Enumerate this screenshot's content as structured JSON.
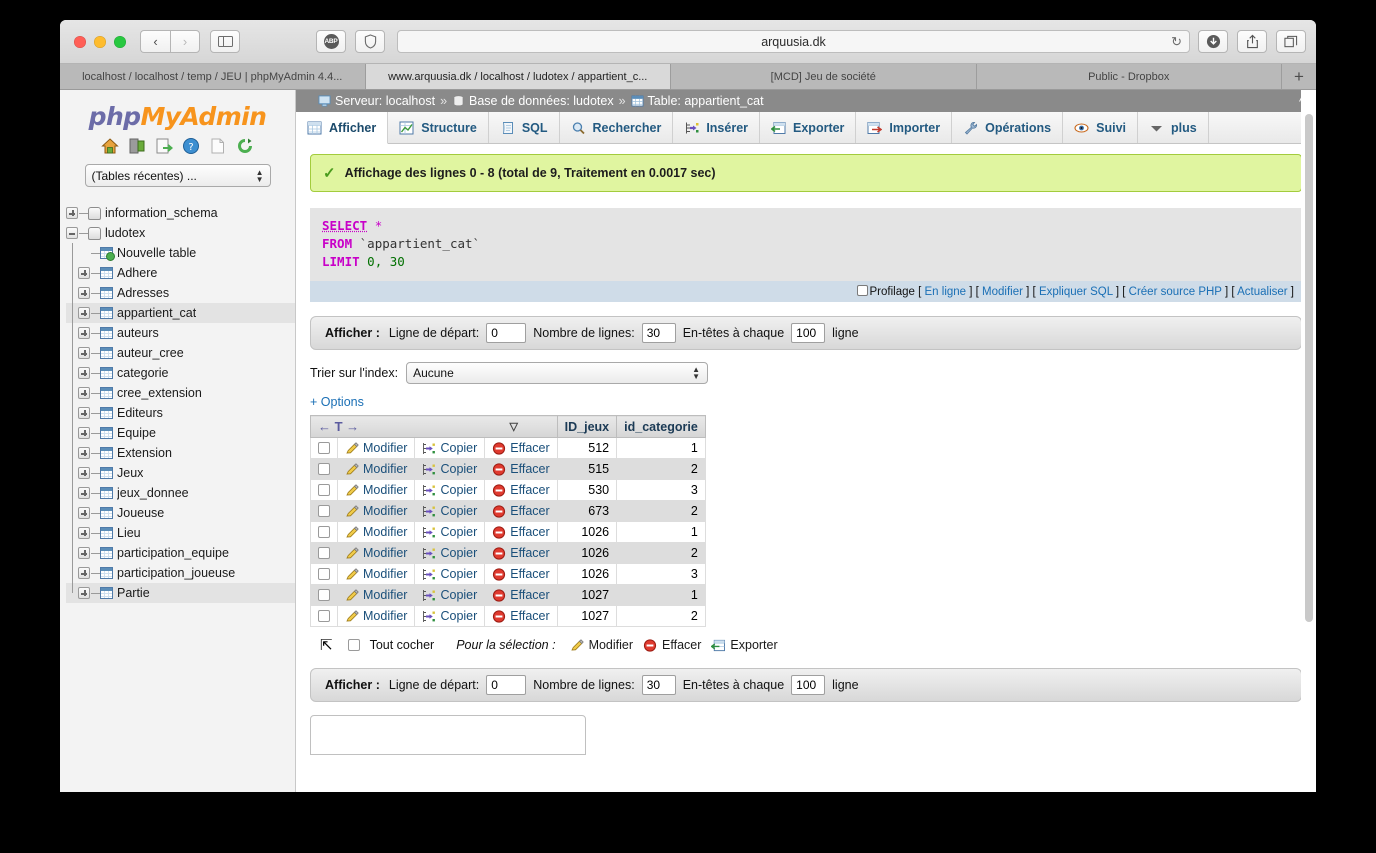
{
  "browser": {
    "url": "arquusia.dk",
    "nav": {
      "back": "‹",
      "forward": "›"
    },
    "tabs": [
      {
        "label": "localhost / localhost / temp / JEU | phpMyAdmin 4.4...",
        "active": false
      },
      {
        "label": "www.arquusia.dk / localhost / ludotex / appartient_c...",
        "active": true
      },
      {
        "label": "[MCD] Jeu de société",
        "active": false
      },
      {
        "label": "Public - Dropbox",
        "active": false
      }
    ],
    "new_tab_label": "+",
    "abp_label": "ABP"
  },
  "sidebar": {
    "logo_php": "php",
    "logo_myadmin": "MyAdmin",
    "icons": [
      "home-icon",
      "exit-icon",
      "export-icon",
      "help-icon",
      "docs-icon",
      "reload-icon"
    ],
    "recent_tables_label": "(Tables récentes) ...",
    "tree": [
      {
        "label": "information_schema",
        "type": "database",
        "toggle": "plus",
        "depth": 0,
        "selected": false
      },
      {
        "label": "ludotex",
        "type": "database",
        "toggle": "minus",
        "depth": 0,
        "selected": false
      },
      {
        "label": "Nouvelle table",
        "type": "new-table",
        "toggle": "none",
        "depth": 1,
        "selected": false
      },
      {
        "label": "Adhere",
        "type": "table",
        "toggle": "plus",
        "depth": 1,
        "selected": false
      },
      {
        "label": "Adresses",
        "type": "table",
        "toggle": "plus",
        "depth": 1,
        "selected": false
      },
      {
        "label": "appartient_cat",
        "type": "table",
        "toggle": "plus",
        "depth": 1,
        "selected": true
      },
      {
        "label": "auteurs",
        "type": "table",
        "toggle": "plus",
        "depth": 1,
        "selected": false
      },
      {
        "label": "auteur_cree",
        "type": "table",
        "toggle": "plus",
        "depth": 1,
        "selected": false
      },
      {
        "label": "categorie",
        "type": "table",
        "toggle": "plus",
        "depth": 1,
        "selected": false
      },
      {
        "label": "cree_extension",
        "type": "table",
        "toggle": "plus",
        "depth": 1,
        "selected": false
      },
      {
        "label": "Editeurs",
        "type": "table",
        "toggle": "plus",
        "depth": 1,
        "selected": false
      },
      {
        "label": "Equipe",
        "type": "table",
        "toggle": "plus",
        "depth": 1,
        "selected": false
      },
      {
        "label": "Extension",
        "type": "table",
        "toggle": "plus",
        "depth": 1,
        "selected": false
      },
      {
        "label": "Jeux",
        "type": "table",
        "toggle": "plus",
        "depth": 1,
        "selected": false
      },
      {
        "label": "jeux_donnee",
        "type": "table",
        "toggle": "plus",
        "depth": 1,
        "selected": false
      },
      {
        "label": "Joueuse",
        "type": "table",
        "toggle": "plus",
        "depth": 1,
        "selected": false
      },
      {
        "label": "Lieu",
        "type": "table",
        "toggle": "plus",
        "depth": 1,
        "selected": false
      },
      {
        "label": "participation_equipe",
        "type": "table",
        "toggle": "plus",
        "depth": 1,
        "selected": false
      },
      {
        "label": "participation_joueuse",
        "type": "table",
        "toggle": "plus",
        "depth": 1,
        "selected": false
      },
      {
        "label": "Partie",
        "type": "table",
        "toggle": "plus",
        "depth": 1,
        "selected": true
      }
    ]
  },
  "breadcrumb": {
    "server_label": "Serveur: localhost",
    "database_label": "Base de données: ludotex",
    "table_label": "Table: appartient_cat",
    "separator": "»"
  },
  "tabs": [
    {
      "label": "Afficher",
      "icon": "table-icon",
      "active": true
    },
    {
      "label": "Structure",
      "icon": "structure-icon",
      "active": false
    },
    {
      "label": "SQL",
      "icon": "sql-icon",
      "active": false
    },
    {
      "label": "Rechercher",
      "icon": "search-icon",
      "active": false
    },
    {
      "label": "Insérer",
      "icon": "insert-icon",
      "active": false
    },
    {
      "label": "Exporter",
      "icon": "export-icon",
      "active": false
    },
    {
      "label": "Importer",
      "icon": "import-icon",
      "active": false
    },
    {
      "label": "Opérations",
      "icon": "wrench-icon",
      "active": false
    },
    {
      "label": "Suivi",
      "icon": "eye-icon",
      "active": false
    },
    {
      "label": "plus",
      "icon": "chevron-down-icon",
      "active": false
    }
  ],
  "success": {
    "message": "Affichage des lignes 0 - 8 (total de 9, Traitement en 0.0017 sec)"
  },
  "sql": {
    "line1_kw": "SELECT",
    "line1_rest": "*",
    "line2_kw": "FROM",
    "line2_rest": "`appartient_cat`",
    "line3_kw": "LIMIT",
    "line3_a": "0",
    "line3_comma": ",",
    "line3_b": "30",
    "profiling_label": "Profilage",
    "links": [
      "En ligne",
      "Modifier",
      "Expliquer SQL",
      "Créer source PHP",
      "Actualiser"
    ]
  },
  "display_bar": {
    "title": "Afficher :",
    "start_row_label": "Ligne de départ:",
    "start_row_value": "0",
    "num_rows_label": "Nombre de lignes:",
    "num_rows_value": "30",
    "headers_label": "En-têtes à chaque",
    "headers_value": "100",
    "line_suffix": "ligne"
  },
  "sort": {
    "label": "Trier sur l'index:",
    "value": "Aucune"
  },
  "options_link": "+ Options",
  "table": {
    "nav_icons": "← T →",
    "sort_caret": "▽",
    "columns": [
      "ID_jeux",
      "id_categorie"
    ],
    "row_actions": [
      "Modifier",
      "Copier",
      "Effacer"
    ],
    "rows": [
      {
        "ID_jeux": "512",
        "id_categorie": "1"
      },
      {
        "ID_jeux": "515",
        "id_categorie": "2"
      },
      {
        "ID_jeux": "530",
        "id_categorie": "3"
      },
      {
        "ID_jeux": "673",
        "id_categorie": "2"
      },
      {
        "ID_jeux": "1026",
        "id_categorie": "1"
      },
      {
        "ID_jeux": "1026",
        "id_categorie": "2"
      },
      {
        "ID_jeux": "1026",
        "id_categorie": "3"
      },
      {
        "ID_jeux": "1027",
        "id_categorie": "1"
      },
      {
        "ID_jeux": "1027",
        "id_categorie": "2"
      }
    ]
  },
  "bulk": {
    "check_all_label": "Tout cocher",
    "for_selection_label": "Pour la sélection :",
    "actions": [
      "Modifier",
      "Effacer",
      "Exporter"
    ]
  },
  "colors": {
    "success_bg": "#e0f5a0",
    "success_border": "#a3cc3d",
    "link": "#1a6fb5",
    "keyword": "#c800c8",
    "number": "#007000",
    "accent_orange": "#f7941d",
    "accent_purple": "#6c6ca8",
    "breadcrumb_bg": "#8a8a8a"
  }
}
